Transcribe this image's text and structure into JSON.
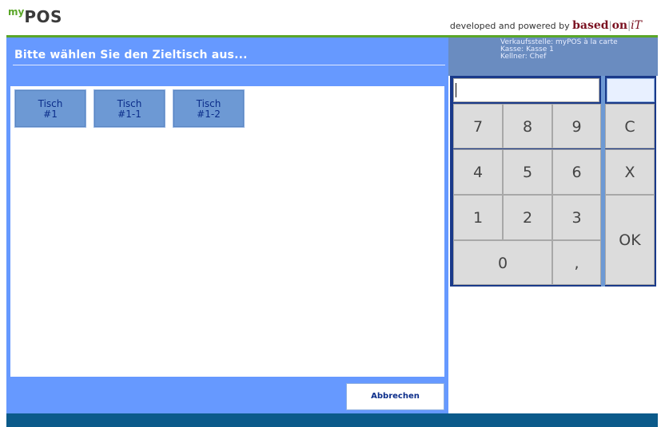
{
  "header": {
    "logo_prefix": "my",
    "logo_name": "POS",
    "powered_by": "developed and powered by",
    "brand_based": "based",
    "brand_sep": "|",
    "brand_on": "on",
    "brand_it": "iT"
  },
  "dialog": {
    "title": "Bitte wählen Sie den Zieltisch aus...",
    "tables": [
      {
        "line1": "Tisch",
        "line2": "#1"
      },
      {
        "line1": "Tisch",
        "line2": "#1-1"
      },
      {
        "line1": "Tisch",
        "line2": "#1-2"
      }
    ],
    "cancel_label": "Abbrechen"
  },
  "info": {
    "verkaufsstelle": "Verkaufsstelle: myPOS à la carte",
    "kasse": "Kasse: Kasse 1",
    "kellner": "Kellner: Chef"
  },
  "keypad": {
    "k7": "7",
    "k8": "8",
    "k9": "9",
    "clear": "C",
    "k4": "4",
    "k5": "5",
    "k6": "6",
    "multiply": "X",
    "k1": "1",
    "k2": "2",
    "k3": "3",
    "ok": "OK",
    "k0": "0",
    "comma": ","
  },
  "colors": {
    "panel_blue": "#6699ff",
    "brand_green": "#5aa628",
    "keypad_frame": "#1a3a8a",
    "bottom_bar": "#0b5a8a"
  }
}
